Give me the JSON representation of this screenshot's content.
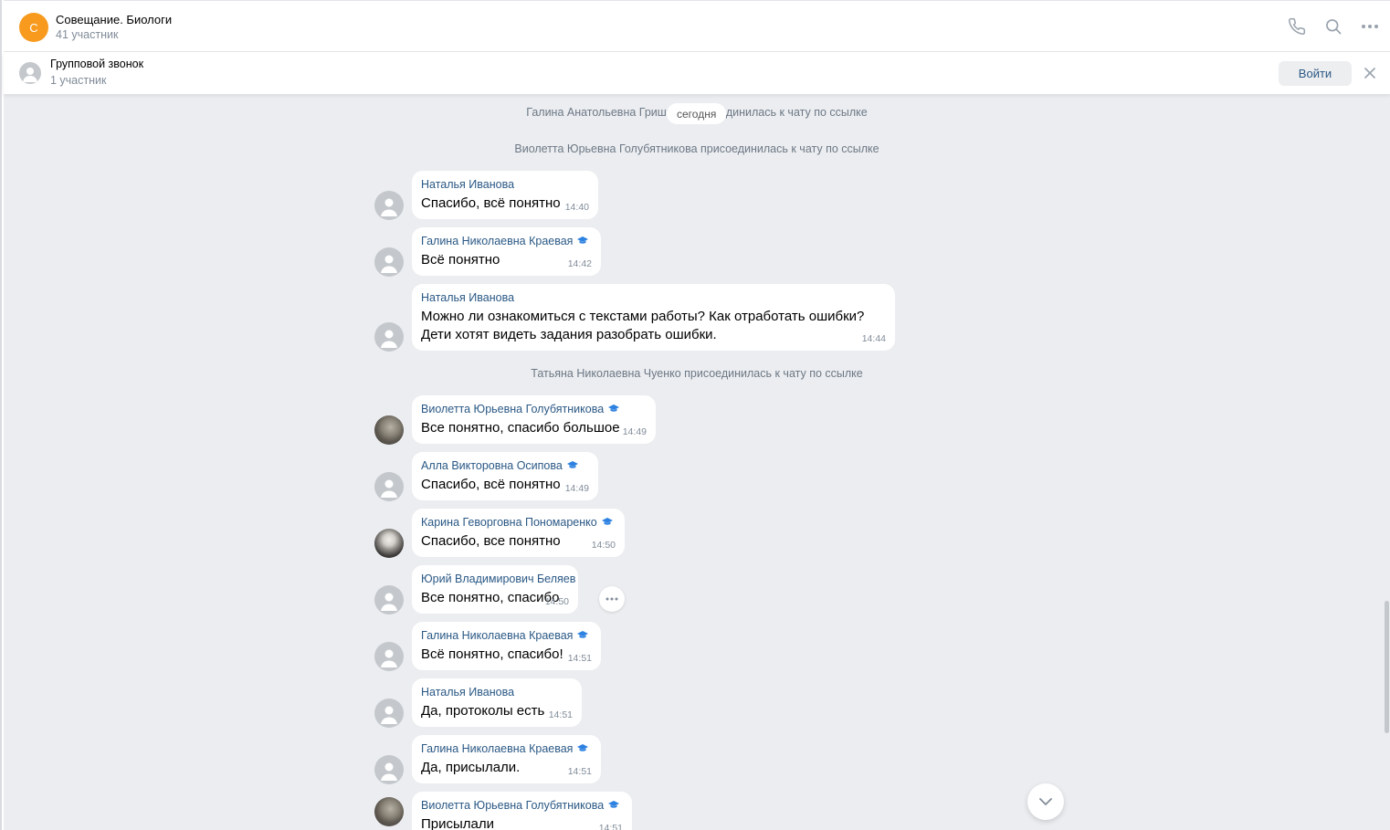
{
  "header": {
    "avatar_letter": "С",
    "title": "Совещание. Биологи",
    "subtitle": "41 участник",
    "icons": [
      "phone-icon",
      "search-icon",
      "more-icon"
    ]
  },
  "call_banner": {
    "title": "Групповой звонок",
    "subtitle": "1 участник",
    "join_label": "Войти"
  },
  "chat": {
    "date_pill": "сегодня",
    "system_messages": [
      "Галина Анатольевна Гришина присоединилась к чату по ссылке",
      "Виолетта Юрьевна Голубятникова присоединилась к чату по ссылке",
      "Татьяна Николаевна Чуенко присоединилась к чату по ссылке"
    ],
    "messages": [
      {
        "author": "Наталья Иванова",
        "badge": false,
        "text": "Спасибо, всё понятно",
        "time": "14:40"
      },
      {
        "author": "Галина Николаевна Краевая",
        "badge": true,
        "text": "Всё понятно",
        "time": "14:42"
      },
      {
        "author": "Наталья Иванова",
        "badge": false,
        "text": "Можно ли ознакомиться с текстами работы? Как отработать ошибки?\nДети хотят видеть задания разобрать ошибки.",
        "time": "14:44"
      },
      {
        "author": "Виолетта Юрьевна Голубятникова",
        "badge": true,
        "text": "Все понятно, спасибо большое",
        "time": "14:49"
      },
      {
        "author": "Алла Викторовна Осипова",
        "badge": true,
        "text": "Спасибо, всё понятно",
        "time": "14:49"
      },
      {
        "author": "Карина Геворговна Пономаренко",
        "badge": true,
        "text": "Спасибо, все понятно",
        "time": "14:50"
      },
      {
        "author": "Юрий Владимирович Беляев",
        "badge": true,
        "text": "Все понятно, спасибо",
        "time": "14:50"
      },
      {
        "author": "Галина Николаевна Краевая",
        "badge": true,
        "text": "Всё понятно, спасибо!",
        "time": "14:51"
      },
      {
        "author": "Наталья Иванова",
        "badge": false,
        "text": "Да, протоколы есть",
        "time": "14:51"
      },
      {
        "author": "Галина Николаевна Краевая",
        "badge": true,
        "text": "Да, присылали.",
        "time": "14:51"
      },
      {
        "author": "Виолетта Юрьевна Голубятникова",
        "badge": true,
        "text": "Присылали",
        "time": "14:51"
      }
    ]
  },
  "colors": {
    "accent_link": "#2a5885",
    "chat_bg": "#ebedf0",
    "chat_avatar": "#f79a1e"
  }
}
